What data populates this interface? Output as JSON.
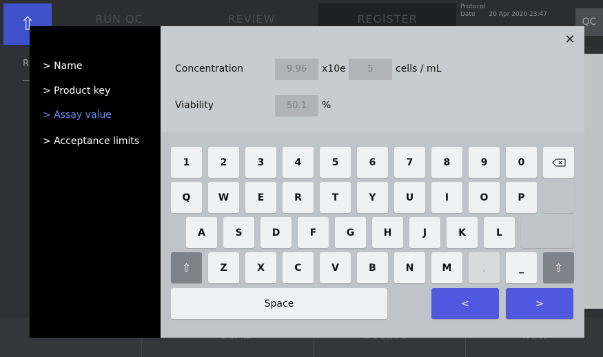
{
  "background": {
    "tabs": [
      "RUN QC",
      "REVIEW",
      "REGISTER"
    ],
    "protocol_label": "Protocol",
    "date_label": "Date",
    "date_value": "20 Apr 2020 23:47",
    "qc_label": "QC",
    "row_letter": "R",
    "bottom_buttons": [
      "LOAD",
      "DELETE",
      "NEW"
    ]
  },
  "sidebar": {
    "items": [
      "> Name",
      "> Product key",
      "> Assay value",
      "> Acceptance limits"
    ],
    "active_index": 2,
    "active_color": "#6f8cff"
  },
  "form": {
    "concentration_label": "Concentration",
    "concentration_mantissa": "9.96",
    "exponent_label": "x10e",
    "concentration_exponent": "5",
    "concentration_unit": "cells / mL",
    "viability_label": "Viability",
    "viability_value": "50.1",
    "viability_unit": "%"
  },
  "close_icon": "close-icon",
  "keyboard": {
    "row1": [
      "1",
      "2",
      "3",
      "4",
      "5",
      "6",
      "7",
      "8",
      "9",
      "0"
    ],
    "row2": [
      "Q",
      "W",
      "E",
      "R",
      "T",
      "Y",
      "U",
      "I",
      "O",
      "P"
    ],
    "row3": [
      "A",
      "S",
      "D",
      "F",
      "G",
      "H",
      "J",
      "K",
      "L"
    ],
    "row4": [
      "Z",
      "X",
      "C",
      "V",
      "B",
      "N",
      "M",
      ",",
      "_"
    ],
    "space_label": "Space",
    "prev_label": "<",
    "next_label": ">",
    "accent_color": "#5158e0",
    "icons": [
      "backspace-icon",
      "shift-icon"
    ]
  }
}
